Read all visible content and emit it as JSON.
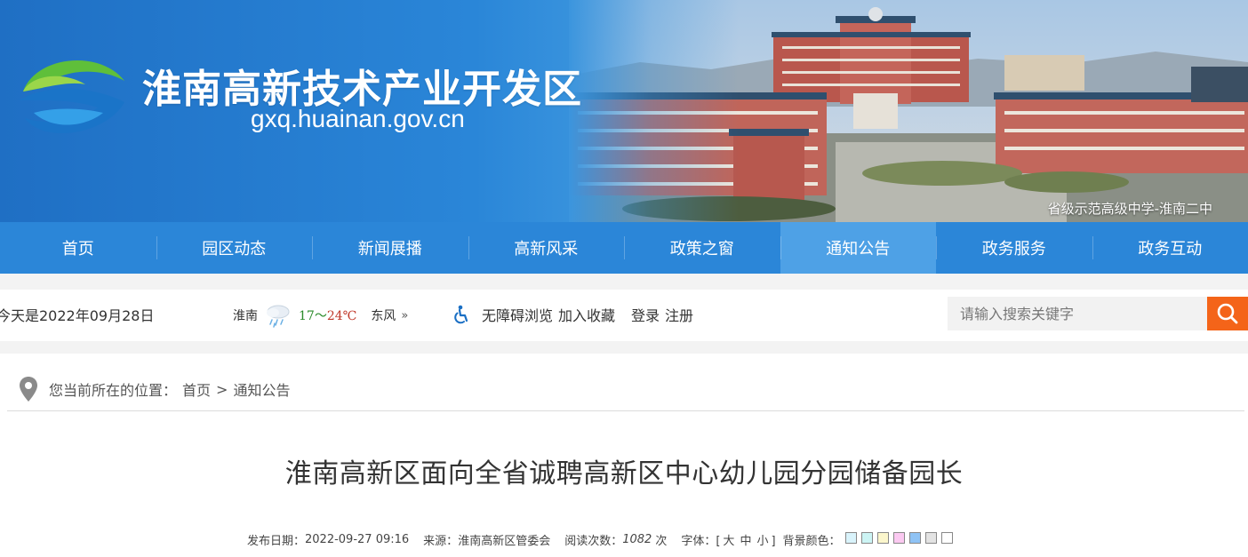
{
  "header": {
    "site_title": "淮南高新技术产业开发区",
    "site_domain": "gxq.huainan.gov.cn",
    "photo_caption": "省级示范高级中学-淮南二中"
  },
  "nav": {
    "items": [
      {
        "label": "首页"
      },
      {
        "label": "园区动态"
      },
      {
        "label": "新闻展播"
      },
      {
        "label": "高新风采"
      },
      {
        "label": "政策之窗"
      },
      {
        "label": "通知公告",
        "active": true
      },
      {
        "label": "政务服务"
      },
      {
        "label": "政务互动"
      }
    ]
  },
  "infobar": {
    "today": "今天是2022年09月28日",
    "weather": {
      "city": "淮南",
      "temp_low": "17",
      "sep": "～",
      "temp_high": "24℃",
      "wind": "东风",
      "more": "»"
    },
    "links": {
      "accessibility": "无障碍浏览",
      "favorite": "加入收藏",
      "login": "登录",
      "register": "注册"
    },
    "search": {
      "placeholder": "请输入搜索关键字"
    }
  },
  "breadcrumb": {
    "prefix": "您当前所在的位置：",
    "home": "首页",
    "separator": ">",
    "current": "通知公告"
  },
  "article": {
    "title": "淮南高新区面向全省诚聘高新区中心幼儿园分园储备园长",
    "meta": {
      "date_label": "发布日期：",
      "date": "2022-09-27 09:16",
      "source_label": "来源：",
      "source": "淮南高新区管委会",
      "views_label": "阅读次数：",
      "views": "1082",
      "views_unit": "次",
      "font_label": "字体：",
      "font_open": "[",
      "font_large": "大",
      "font_medium": "中",
      "font_small": "小",
      "font_close": "]",
      "bg_label": "背景颜色："
    },
    "bg_colors": [
      "#d9f3fb",
      "#ccf4f4",
      "#fbf6cc",
      "#fbc9f1",
      "#8fc3f5",
      "#e3e3e3",
      "#ffffff"
    ]
  },
  "colors": {
    "nav_bg": "#2b86d8",
    "nav_active": "#4ea1e6",
    "search_button": "#f46419"
  }
}
